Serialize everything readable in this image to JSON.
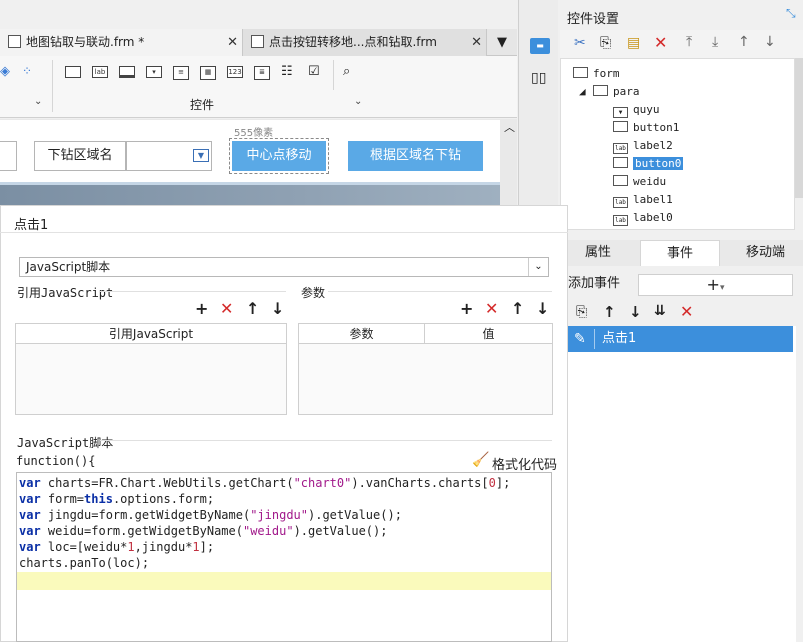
{
  "tabs": [
    {
      "label": "地图钻取与联动.frm *"
    },
    {
      "label": "点击按钮转移地...点和钻取.frm"
    }
  ],
  "widget_toolbar": {
    "label": "控件"
  },
  "form": {
    "drill_label": "下钻区域名",
    "center_button": "中心点移动",
    "drill_button": "根据区域名下钻",
    "width_hint": "555像素"
  },
  "control_settings": {
    "title": "控件设置",
    "tree": {
      "root": "form",
      "group": "para",
      "items": [
        "quyu",
        "button1",
        "label2",
        "button0",
        "weidu",
        "label1",
        "label0"
      ],
      "selected": "button0"
    }
  },
  "right_tabs": [
    "属性",
    "事件",
    "移动端"
  ],
  "events": {
    "add_label": "添加事件",
    "add_symbol": "+",
    "items": [
      "点击1"
    ]
  },
  "dialog": {
    "title": "点击1",
    "script_type": "JavaScript脚本",
    "ref_section": "引用JavaScript",
    "ref_column": "引用JavaScript",
    "param_section": "参数",
    "param_columns": [
      "参数",
      "值"
    ],
    "script_section": "JavaScript脚本",
    "func_header": "function(){",
    "format_label": "格式化代码",
    "code_lines": [
      "var charts=FR.Chart.WebUtils.getChart(\"chart0\").vanCharts.charts[0];",
      "var form=this.options.form;",
      "var jingdu=form.getWidgetByName(\"jingdu\").getValue();",
      "var weidu=form.getWidgetByName(\"weidu\").getValue();",
      "var loc=[weidu*1,jingdu*1];",
      "charts.panTo(loc);"
    ]
  },
  "colors": {
    "accent": "#3c8fdc",
    "button": "#5aa9e6",
    "delete": "#d42a2a"
  }
}
